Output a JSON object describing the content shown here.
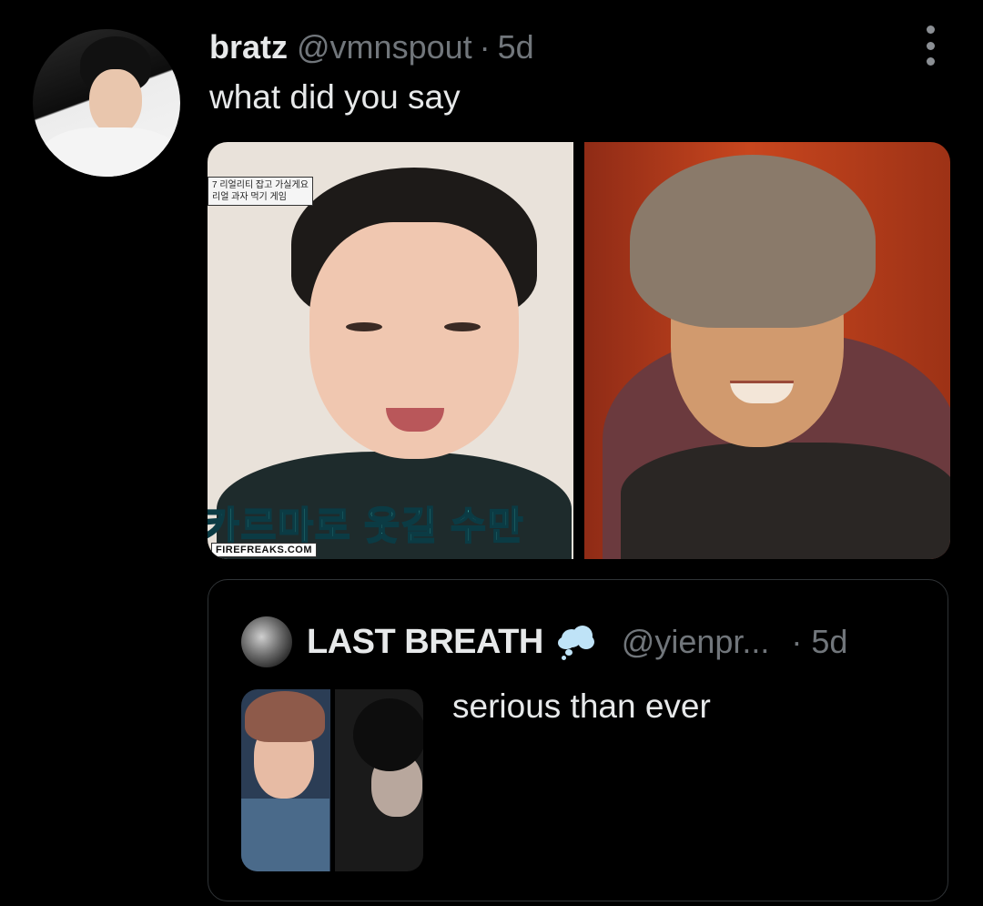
{
  "tweet": {
    "display_name": "bratz",
    "handle": "@vmnspout",
    "separator": "·",
    "time": "5d",
    "text": "what did you say",
    "media": {
      "photo_1": {
        "caption_line_1": "7 리얼리티 잡고 가실게요",
        "caption_line_2": "리얼 과자 먹기 게임",
        "overlay_text": "카르마로 웃길 수만",
        "watermark": "FIREFREAKS.COM"
      }
    }
  },
  "quoted_tweet": {
    "display_name": "LAST BREATH",
    "emoji": "thought-balloon",
    "handle": "@yienpr...",
    "separator": "·",
    "time": "5d",
    "text": "serious than ever"
  },
  "colors": {
    "background": "#000000",
    "primary_text": "#e7e9ea",
    "secondary_text": "#71767b",
    "border": "#2f3336"
  }
}
